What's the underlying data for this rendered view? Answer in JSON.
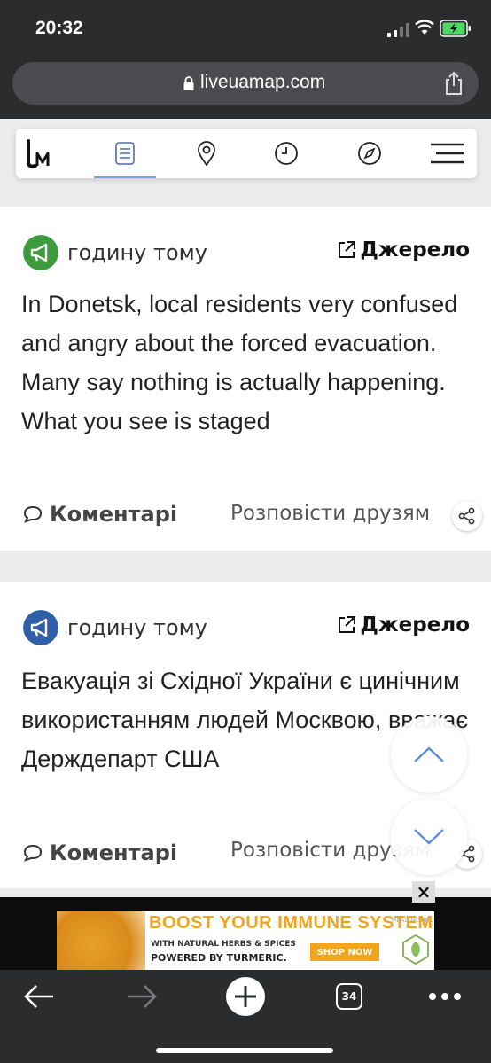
{
  "status_bar": {
    "time": "20:32"
  },
  "browser": {
    "url": "liveuamap.com"
  },
  "nav": {
    "logo_text": "LM",
    "items": [
      "news-feed",
      "map-pin",
      "clock",
      "compass",
      "menu"
    ]
  },
  "feed": [
    {
      "time_ago": "годину тому",
      "source_label": "Джерело",
      "text": "In Donetsk, local residents very confused and angry about the forced evacuation. Many say nothing is actually happening. What you see is staged",
      "comments_label": "Коментарі",
      "share_label": "Розповісти друзям",
      "badge_color": "#3d9a3d"
    },
    {
      "time_ago": "годину тому",
      "source_label": "Джерело",
      "text": "Евакуація зі Східної України є цинічним використанням людей Москвою, вважає Держдепарт США",
      "comments_label": "Коментарі",
      "share_label": "Розповісти друзям",
      "badge_color": "#2f5fa8"
    }
  ],
  "ad": {
    "headline": "BOOST YOUR IMMUNE SYSTEM",
    "sub1": "WITH NATURAL HERBS & SPICES",
    "sub2": "POWERED BY TURMERIC.",
    "cta": "SHOP NOW",
    "brand": "HEALTHGURU",
    "close": "×"
  },
  "toolbar": {
    "tab_count": "34"
  }
}
